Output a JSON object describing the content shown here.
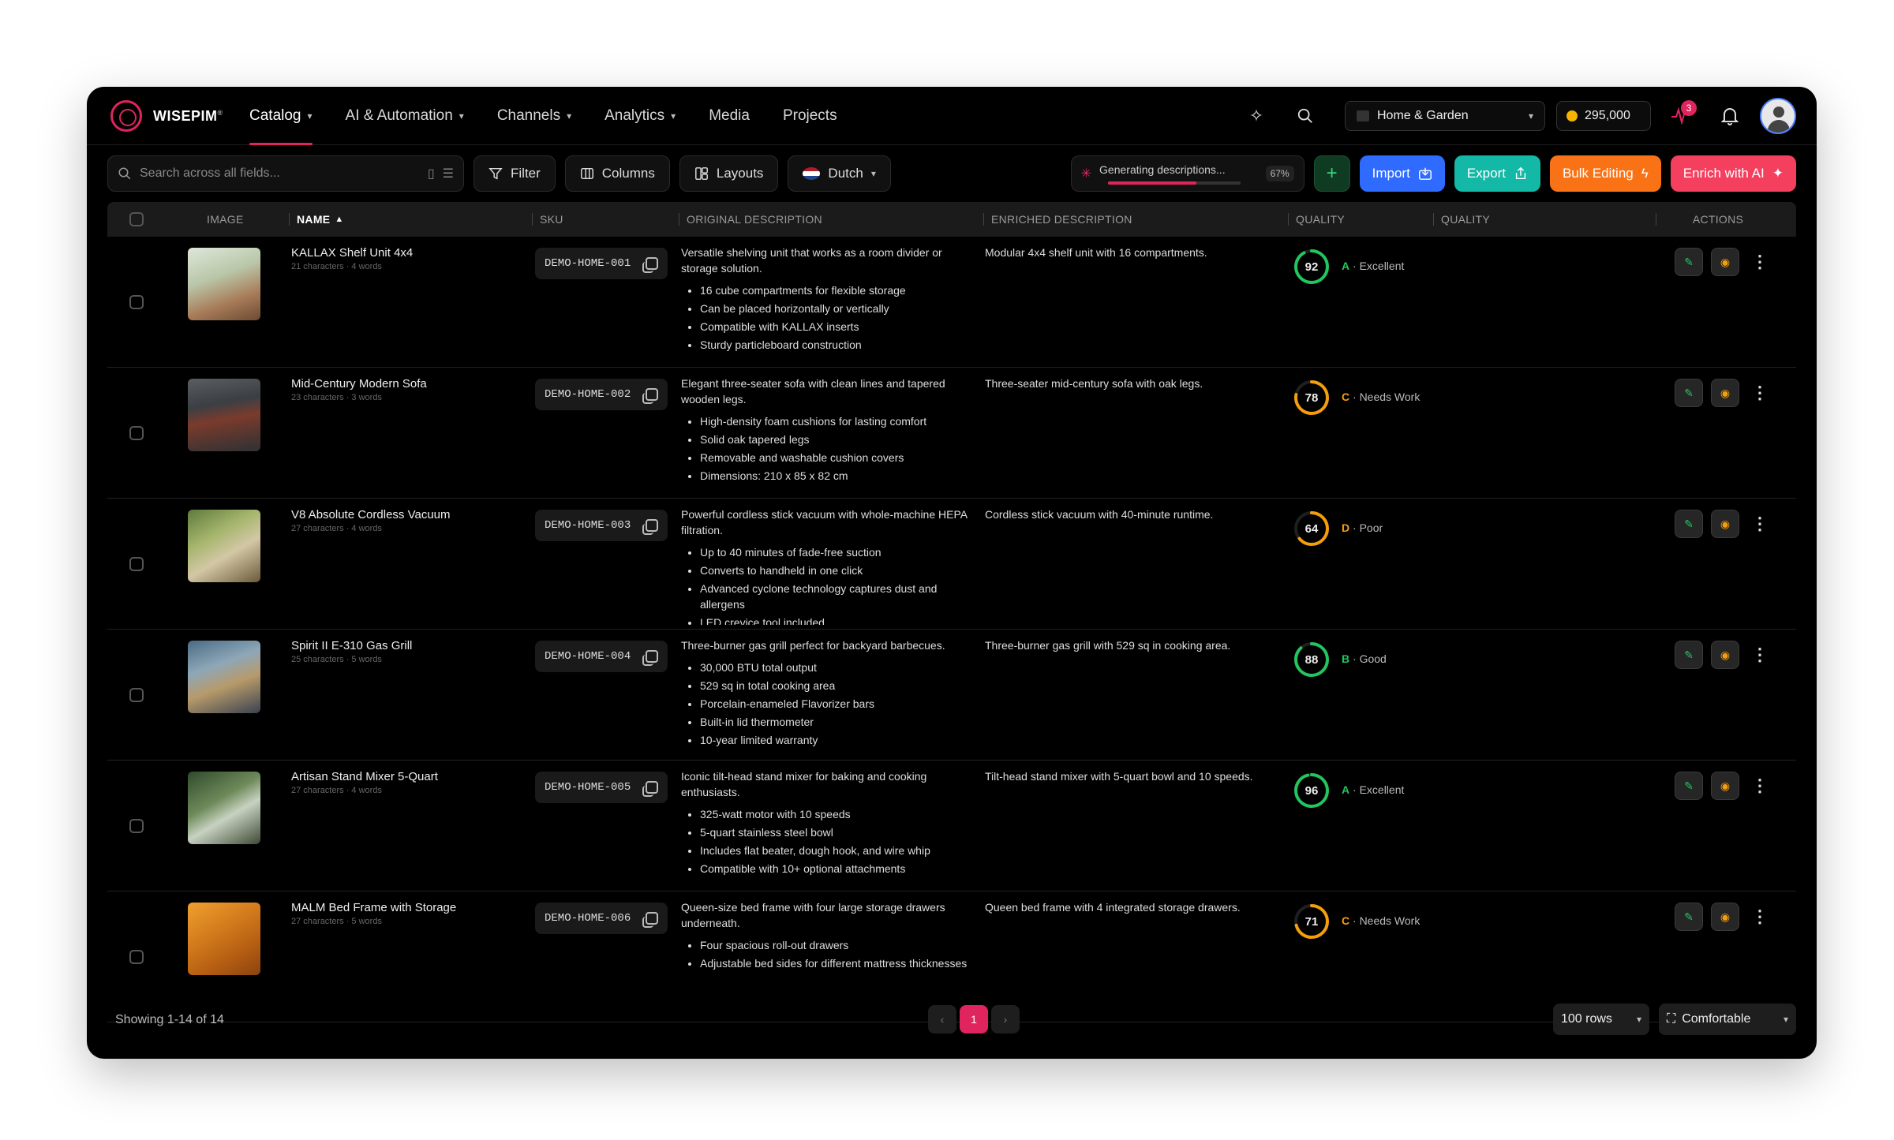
{
  "app": {
    "brand": "WISEPIM",
    "brand_mark": "®"
  },
  "nav": {
    "items": [
      {
        "label": "Catalog",
        "dropdown": true,
        "active": true
      },
      {
        "label": "AI & Automation",
        "dropdown": true
      },
      {
        "label": "Channels",
        "dropdown": true
      },
      {
        "label": "Analytics",
        "dropdown": true
      },
      {
        "label": "Media",
        "dropdown": false
      },
      {
        "label": "Projects",
        "dropdown": false
      }
    ],
    "workspace": "Home & Garden",
    "credits": "295,000",
    "activity_badge": "3"
  },
  "toolbar": {
    "search_placeholder": "Search across all fields...",
    "filter": "Filter",
    "columns": "Columns",
    "layouts": "Layouts",
    "language": "Dutch",
    "generating": "Generating descriptions...",
    "generating_pct": "67%",
    "generating_progress": 0.67,
    "import": "Import",
    "export": "Export",
    "bulk_editing": "Bulk Editing",
    "enrich": "Enrich with AI"
  },
  "table": {
    "headers": {
      "image": "IMAGE",
      "name": "NAME",
      "sku": "SKU",
      "original": "ORIGINAL DESCRIPTION",
      "enriched": "ENRICHED DESCRIPTION",
      "quality1": "QUALITY",
      "quality2": "QUALITY",
      "actions": "ACTIONS"
    },
    "rows": [
      {
        "name": "KALLAX Shelf Unit 4x4",
        "meta": "21 characters · 4 words",
        "sku": "DEMO-HOME-001",
        "orig": "Versatile shelving unit that works as a room divider or storage solution.",
        "bullets": [
          "16 cube compartments for flexible storage",
          "Can be placed horizontally or vertically",
          "Compatible with KALLAX inserts",
          "Sturdy particleboard construction"
        ],
        "enriched": "Modular 4x4 shelf unit with 16 compartments.",
        "score": "92",
        "grade": "A",
        "grade_label": "· Excellent"
      },
      {
        "name": "Mid-Century Modern Sofa",
        "meta": "23 characters · 3 words",
        "sku": "DEMO-HOME-002",
        "orig": "Elegant three-seater sofa with clean lines and tapered wooden legs.",
        "bullets": [
          "High-density foam cushions for lasting comfort",
          "Solid oak tapered legs",
          "Removable and washable cushion covers",
          "Dimensions: 210 x 85 x 82 cm"
        ],
        "enriched": "Three-seater mid-century sofa with oak legs.",
        "score": "78",
        "grade": "C",
        "grade_label": "· Needs Work"
      },
      {
        "name": "V8 Absolute Cordless Vacuum",
        "meta": "27 characters · 4 words",
        "sku": "DEMO-HOME-003",
        "orig": "Powerful cordless stick vacuum with whole-machine HEPA filtration.",
        "bullets": [
          "Up to 40 minutes of fade-free suction",
          "Converts to handheld in one click",
          "Advanced cyclone technology captures dust and allergens",
          "LED crevice tool included"
        ],
        "enriched": "Cordless stick vacuum with 40-minute runtime.",
        "score": "64",
        "grade": "D",
        "grade_label": "· Poor"
      },
      {
        "name": "Spirit II E-310 Gas Grill",
        "meta": "25 characters · 5 words",
        "sku": "DEMO-HOME-004",
        "orig": "Three-burner gas grill perfect for backyard barbecues.",
        "bullets": [
          "30,000 BTU total output",
          "529 sq in total cooking area",
          "Porcelain-enameled Flavorizer bars",
          "Built-in lid thermometer",
          "10-year limited warranty"
        ],
        "enriched": "Three-burner gas grill with 529 sq in cooking area.",
        "score": "88",
        "grade": "B",
        "grade_label": "· Good"
      },
      {
        "name": "Artisan Stand Mixer 5-Quart",
        "meta": "27 characters · 4 words",
        "sku": "DEMO-HOME-005",
        "orig": "Iconic tilt-head stand mixer for baking and cooking enthusiasts.",
        "bullets": [
          "325-watt motor with 10 speeds",
          "5-quart stainless steel bowl",
          "Includes flat beater, dough hook, and wire whip",
          "Compatible with 10+ optional attachments"
        ],
        "enriched": "Tilt-head stand mixer with 5-quart bowl and 10 speeds.",
        "score": "96",
        "grade": "A",
        "grade_label": "· Excellent"
      },
      {
        "name": "MALM Bed Frame with Storage",
        "meta": "27 characters · 5 words",
        "sku": "DEMO-HOME-006",
        "orig": "Queen-size bed frame with four large storage drawers underneath.",
        "bullets": [
          "Four spacious roll-out drawers",
          "Adjustable bed sides for different mattress thicknesses"
        ],
        "enriched": "Queen bed frame with 4 integrated storage drawers.",
        "score": "71",
        "grade": "C",
        "grade_label": "· Needs Work"
      }
    ]
  },
  "colors": {
    "accent": "#e0245e",
    "green": "#22c55e",
    "orange": "#f59e0b",
    "import": "#2f6bff",
    "export": "#14b8a6",
    "bulk": "#f97316",
    "enrich": "#f43f5e"
  },
  "footer": {
    "showing": "Showing 1-14 of 14",
    "page": "1",
    "rows": "100 rows",
    "density": "Comfortable"
  }
}
